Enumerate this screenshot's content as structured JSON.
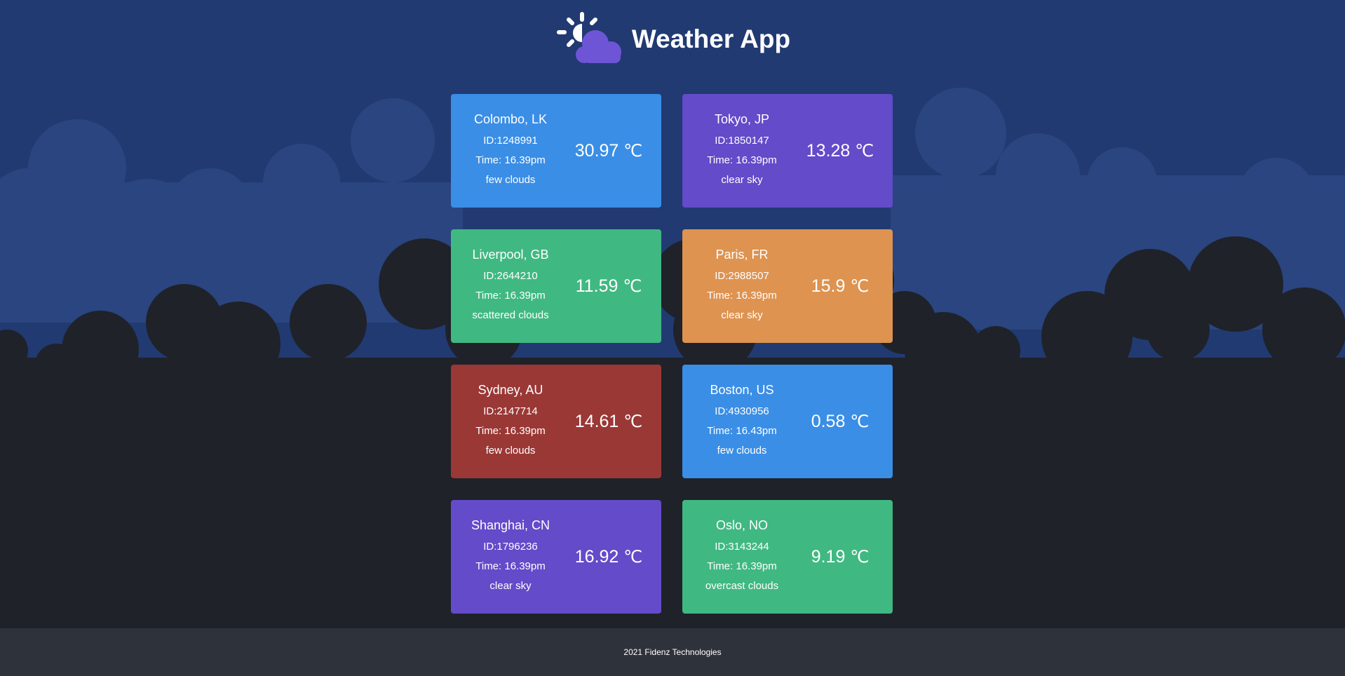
{
  "app": {
    "title": "Weather App",
    "logo_icon": "sun-behind-cloud-icon"
  },
  "colors": {
    "page_bg": "#1f2229",
    "sky_bg": "#213a72",
    "blue": "#3a8ee6",
    "purple": "#634bc9",
    "green": "#40b882",
    "orange": "#de9350",
    "red": "#9a3836",
    "footer_bg": "#2e323a"
  },
  "cards": [
    {
      "city": "Colombo, LK",
      "id": "ID:1248991",
      "time": "Time: 16.39pm",
      "desc": "few clouds",
      "temp": "30.97",
      "unit": "℃",
      "color": "#3a8ee6"
    },
    {
      "city": "Tokyo, JP",
      "id": "ID:1850147",
      "time": "Time: 16.39pm",
      "desc": "clear sky",
      "temp": "13.28",
      "unit": "℃",
      "color": "#634bc9"
    },
    {
      "city": "Liverpool, GB",
      "id": "ID:2644210",
      "time": "Time: 16.39pm",
      "desc": "scattered clouds",
      "temp": "11.59",
      "unit": "℃",
      "color": "#40b882"
    },
    {
      "city": "Paris, FR",
      "id": "ID:2988507",
      "time": "Time: 16.39pm",
      "desc": "clear sky",
      "temp": "15.9",
      "unit": "℃",
      "color": "#de9350"
    },
    {
      "city": "Sydney, AU",
      "id": "ID:2147714",
      "time": "Time: 16.39pm",
      "desc": "few clouds",
      "temp": "14.61",
      "unit": "℃",
      "color": "#9a3836"
    },
    {
      "city": "Boston, US",
      "id": "ID:4930956",
      "time": "Time: 16.43pm",
      "desc": "few clouds",
      "temp": "0.58",
      "unit": "℃",
      "color": "#3a8ee6"
    },
    {
      "city": "Shanghai, CN",
      "id": "ID:1796236",
      "time": "Time: 16.39pm",
      "desc": "clear sky",
      "temp": "16.92",
      "unit": "℃",
      "color": "#634bc9"
    },
    {
      "city": "Oslo, NO",
      "id": "ID:3143244",
      "time": "Time: 16.39pm",
      "desc": "overcast clouds",
      "temp": "9.19",
      "unit": "℃",
      "color": "#40b882"
    }
  ],
  "footer": {
    "text": "2021 Fidenz Technologies"
  }
}
